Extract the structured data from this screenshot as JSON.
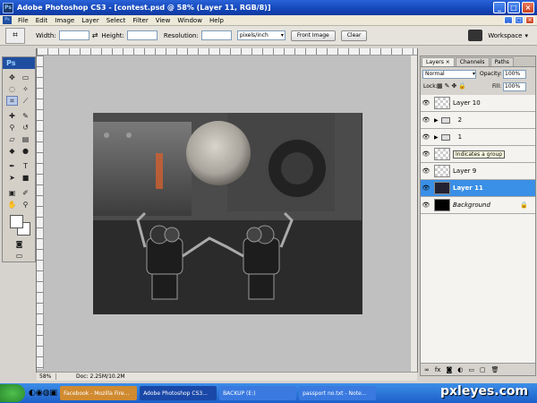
{
  "titlebar": {
    "title": "Adobe Photoshop CS3 - [contest.psd @ 58% (Layer 11, RGB/8)]"
  },
  "menu": [
    "File",
    "Edit",
    "Image",
    "Layer",
    "Select",
    "Filter",
    "View",
    "Window",
    "Help"
  ],
  "options": {
    "width_label": "Width:",
    "height_label": "Height:",
    "resolution_label": "Resolution:",
    "units": "pixels/inch",
    "front_image": "Front Image",
    "clear": "Clear",
    "workspace": "Workspace"
  },
  "toolbox": {
    "logo": "Ps"
  },
  "status": {
    "zoom": "58%",
    "doc": "Doc: 2.25M/10.2M"
  },
  "layers_panel": {
    "tabs": [
      "Layers ×",
      "Channels",
      "Paths"
    ],
    "blend_mode": "Normal",
    "opacity_label": "Opacity:",
    "opacity": "100%",
    "lock_label": "Lock:",
    "fill_label": "Fill:",
    "fill": "100%",
    "layers": [
      {
        "name": "Layer 10",
        "type": "layer"
      },
      {
        "name": "2",
        "type": "group"
      },
      {
        "name": "1",
        "type": "group"
      },
      {
        "name": "Indicates a group",
        "type": "tooltip"
      },
      {
        "name": "Layer 9",
        "type": "layer"
      },
      {
        "name": "Layer 11",
        "type": "layer"
      },
      {
        "name": "Background",
        "type": "background"
      }
    ]
  },
  "taskbar": {
    "items": [
      "Facebook - Mozilla Fire...",
      "Adobe Photoshop CS3...",
      "BACKUP (E:)",
      "passport no.txt - Note..."
    ]
  },
  "watermark": "pxleyes.com"
}
